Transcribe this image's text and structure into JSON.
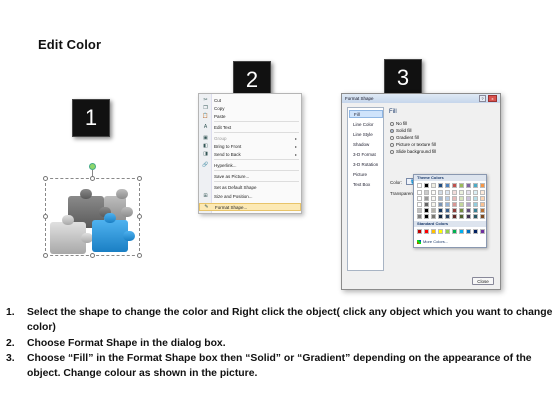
{
  "title": "Edit Color",
  "steps": {
    "one": "1",
    "two": "2",
    "three": "3"
  },
  "context_menu": {
    "items": [
      {
        "label": "Cut",
        "icon": "scissors-icon",
        "glyph": "✂"
      },
      {
        "label": "Copy",
        "icon": "copy-icon",
        "glyph": "❐"
      },
      {
        "label": "Paste",
        "icon": "paste-icon",
        "glyph": "📋"
      },
      {
        "label": "Edit Text",
        "icon": "edit-text-icon",
        "glyph": "A"
      },
      {
        "label": "Group",
        "icon": "group-icon",
        "glyph": "▣"
      },
      {
        "label": "Bring to Front",
        "icon": "bring-front-icon",
        "glyph": "◧"
      },
      {
        "label": "Send to Back",
        "icon": "send-back-icon",
        "glyph": "◨"
      },
      {
        "label": "Hyperlink...",
        "icon": "hyperlink-icon",
        "glyph": "🔗"
      },
      {
        "label": "Save as Picture...",
        "icon": "",
        "glyph": ""
      },
      {
        "label": "Set as Default Shape",
        "icon": "",
        "glyph": ""
      },
      {
        "label": "Size and Position...",
        "icon": "size-position-icon",
        "glyph": "⊞"
      },
      {
        "label": "Format Shape...",
        "icon": "format-shape-icon",
        "glyph": "✎"
      }
    ]
  },
  "dialog": {
    "title": "Format Shape",
    "help": "?",
    "close_x": "x",
    "nav": [
      "Fill",
      "Line Color",
      "Line Style",
      "Shadow",
      "3-D Format",
      "3-D Rotation",
      "Picture",
      "Text Box"
    ],
    "heading": "Fill",
    "options": [
      "No fill",
      "Solid fill",
      "Gradient fill",
      "Picture or texture fill",
      "Slide background fill"
    ],
    "color_label": "Color:",
    "transparency_label": "Transparency:",
    "close_button": "Close"
  },
  "palette": {
    "theme_header": "Theme Colors",
    "standard_header": "Standard Colors",
    "more": "More Colors...",
    "theme_top": [
      "#ffffff",
      "#000000",
      "#eeece1",
      "#1f497d",
      "#4f81bd",
      "#c0504d",
      "#9bbb59",
      "#8064a2",
      "#4bacc6",
      "#f79646"
    ],
    "standard": [
      "#c00000",
      "#ff0000",
      "#ffc000",
      "#ffff00",
      "#92d050",
      "#00b050",
      "#00b0f0",
      "#0070c0",
      "#002060",
      "#7030a0"
    ]
  },
  "instructions": [
    {
      "num": "1.",
      "text": "Select the shape to change the color and Right click the object( click any object which you want to change color)"
    },
    {
      "num": "2.",
      "text": "Choose Format Shape in the dialog box."
    },
    {
      "num": "3.",
      "text": "Choose “Fill” in the Format Shape box then “Solid” or “Gradient” depending on the appearance of the object. Change colour as shown in the picture."
    }
  ]
}
